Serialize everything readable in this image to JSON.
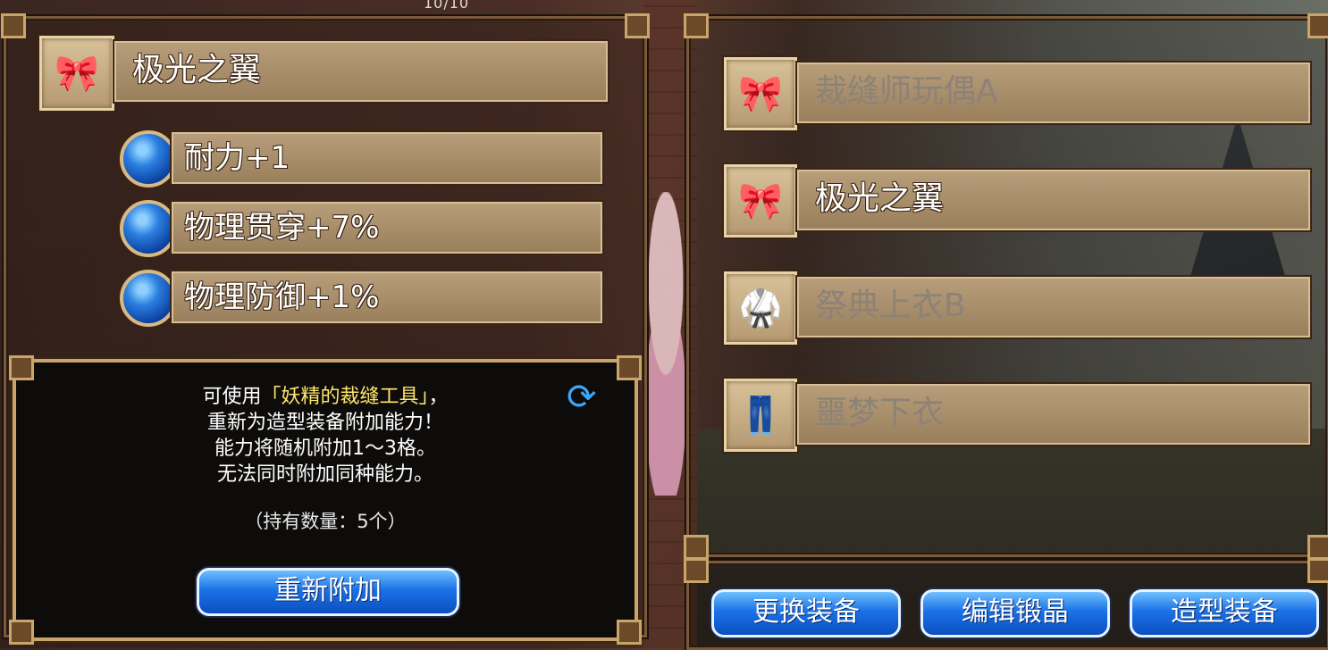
{
  "top_counter": "10/10",
  "left": {
    "selected_item": {
      "name": "极光之翼",
      "icon": "red-ribbon-icon"
    },
    "stats": [
      {
        "label": "耐力+1"
      },
      {
        "label": "物理贯穿+7%"
      },
      {
        "label": "物理防御+1%"
      }
    ],
    "description": {
      "line1_prefix": "可使用",
      "line1_highlight": "「妖精的裁缝工具」",
      "line1_suffix": "，",
      "line2": "重新为造型装备附加能力！",
      "line3": "能力将随机附加1～3格。",
      "line4": "无法同时附加同种能力。",
      "quantity": "（持有数量：5个）",
      "refresh_icon": "refresh-icon"
    },
    "reattach_button": "重新附加"
  },
  "right": {
    "items": [
      {
        "name": "裁缝师玩偶A",
        "icon": "red-ribbon-icon",
        "active": false
      },
      {
        "name": "极光之翼",
        "icon": "red-ribbon-icon",
        "active": true
      },
      {
        "name": "祭典上衣B",
        "icon": "teal-armor-top-icon",
        "active": false
      },
      {
        "name": "噩梦下衣",
        "icon": "teal-armor-bottom-icon",
        "active": false
      }
    ]
  },
  "bottom_buttons": {
    "change_equipment": "更换装备",
    "edit_crystal": "编辑锻晶",
    "style_equipment": "造型装备"
  }
}
